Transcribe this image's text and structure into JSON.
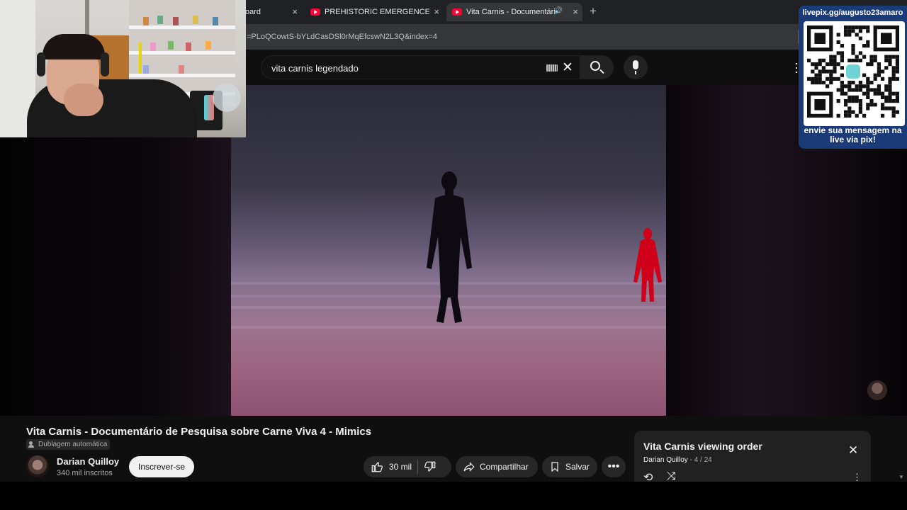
{
  "browser": {
    "tabs": [
      {
        "title": "oard"
      },
      {
        "title": "PREHISTORIC EMERGENCE: A W"
      },
      {
        "title": "Vita Carnis - Documentário"
      }
    ],
    "tab_close": "×",
    "new_tab": "+",
    "url": "=PLoQCowtS-bYLdCasDSl0rMqEfcswN2L3Q&index=4"
  },
  "youtube": {
    "search": {
      "query": "vita carnis legendado",
      "clear_icon": "✕"
    },
    "video": {
      "title": "Vita Carnis - Documentário de Pesquisa sobre Carne Viva 4 - Mimics",
      "dub_label": "Dublagem automática"
    },
    "channel": {
      "name": "Darian Quilloy",
      "subscribers": "340 mil inscritos"
    },
    "subscribe_label": "Inscrever-se",
    "actions": {
      "likes": "30 mil",
      "share": "Compartilhar",
      "save": "Salvar",
      "more": "•••"
    },
    "playlist": {
      "title": "Vita Carnis viewing order",
      "channel": "Darian Quilloy",
      "position": "4 / 24",
      "close_icon": "✕"
    }
  },
  "stream_overlay": {
    "pix_url": "livepix.gg/augusto23amaro",
    "pix_caption": "envie sua mensagem na live via pix!"
  },
  "colors": {
    "yt_red": "#ff0033",
    "overlay_blue": "#1b3a78",
    "mimic_red": "#d0001a",
    "bg": "#0f0f0f"
  }
}
